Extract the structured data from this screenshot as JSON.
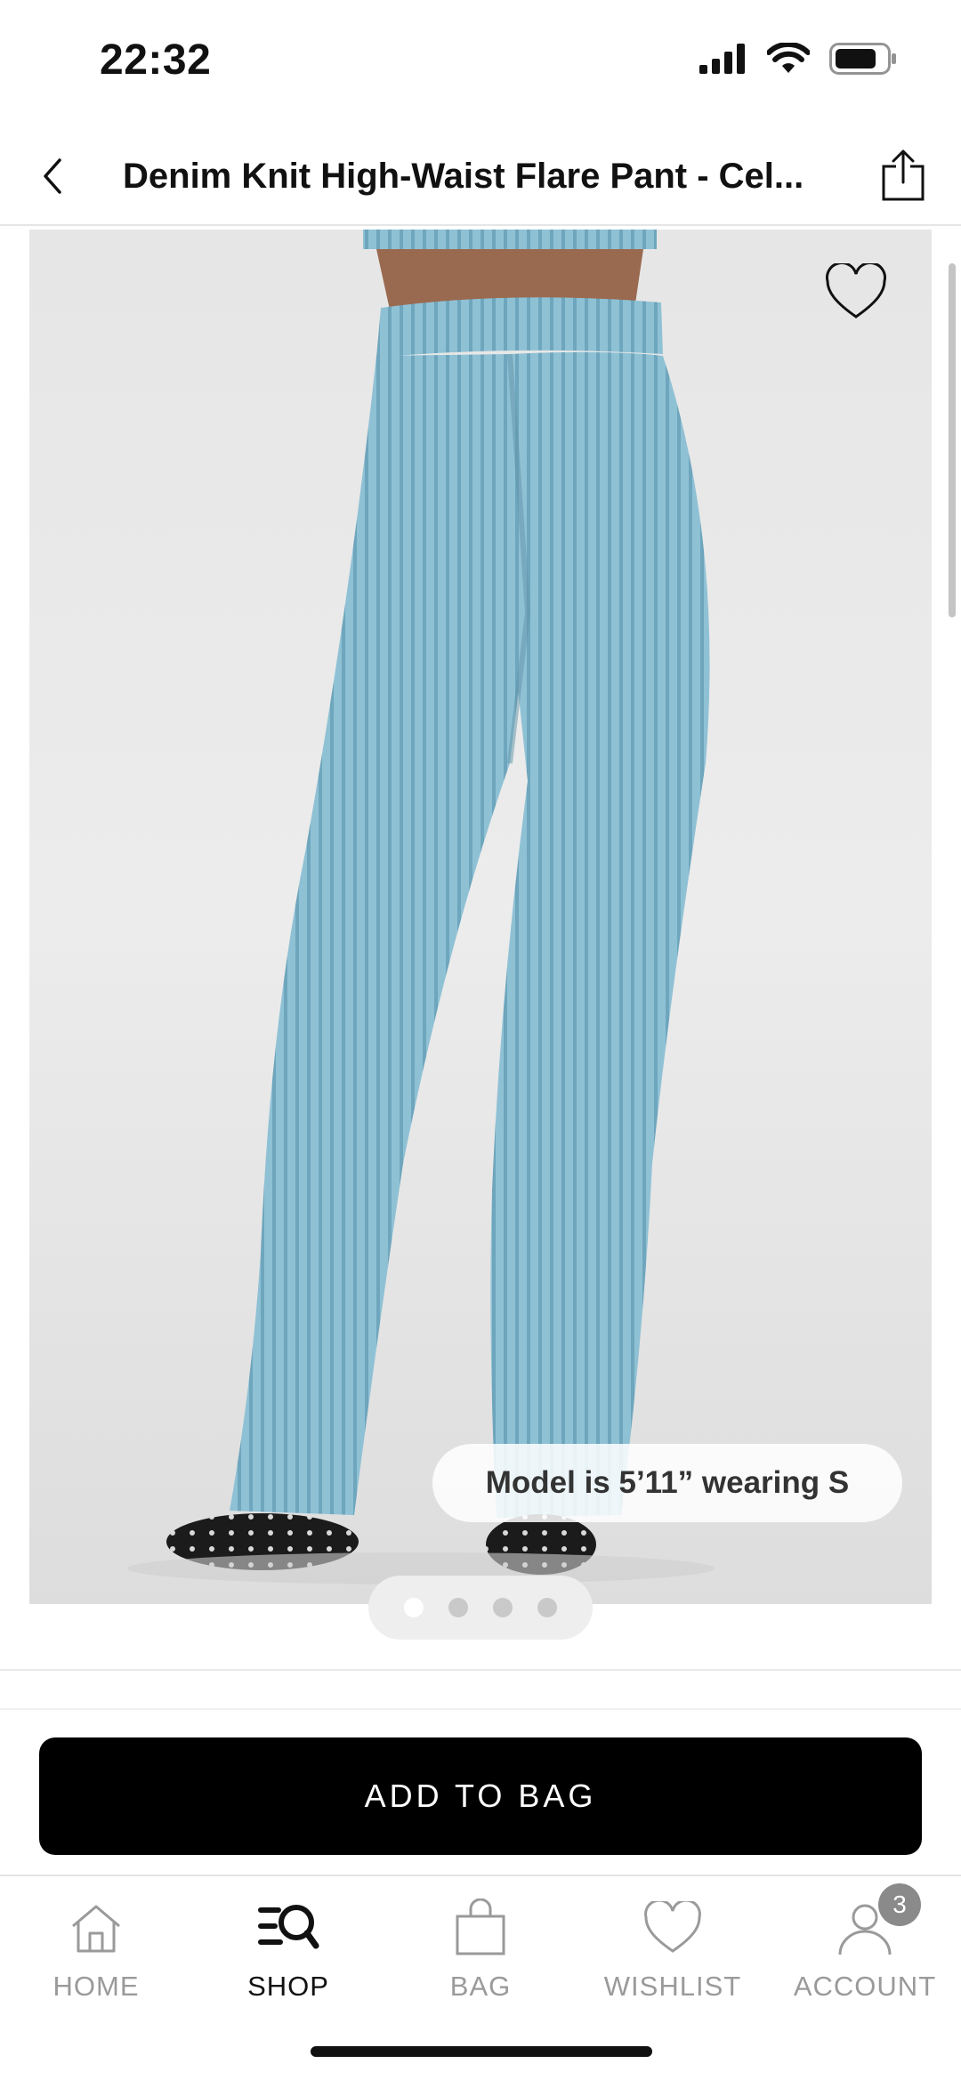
{
  "status_bar": {
    "time": "22:32"
  },
  "header": {
    "title": "Denim Knit High-Waist Flare Pant - Cel...",
    "back_icon": "chevron-left-icon",
    "share_icon": "share-icon"
  },
  "gallery": {
    "model_info": "Model is 5’11” wearing S",
    "image_count": 4,
    "active_index": 0,
    "wishlist_icon": "heart-icon",
    "product_color": "#8dbfd3"
  },
  "actions": {
    "add_to_bag": "ADD TO BAG"
  },
  "tab_bar": {
    "items": [
      {
        "label": "HOME",
        "icon": "home-icon",
        "active": false
      },
      {
        "label": "SHOP",
        "icon": "shop-search-icon",
        "active": true
      },
      {
        "label": "BAG",
        "icon": "bag-icon",
        "active": false
      },
      {
        "label": "WISHLIST",
        "icon": "heart-icon",
        "active": false
      },
      {
        "label": "ACCOUNT",
        "icon": "account-icon",
        "active": false,
        "badge": "3"
      }
    ]
  }
}
